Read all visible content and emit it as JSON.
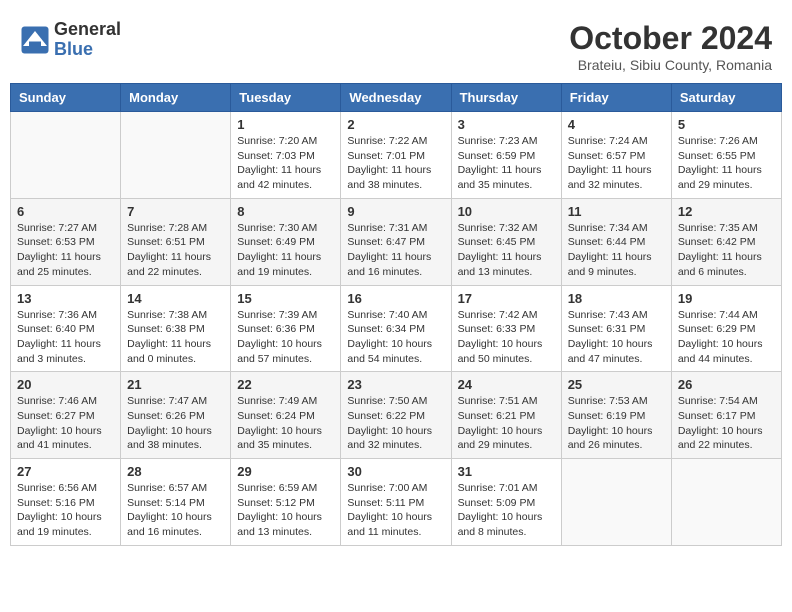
{
  "header": {
    "logo_general": "General",
    "logo_blue": "Blue",
    "month_year": "October 2024",
    "location": "Brateiu, Sibiu County, Romania"
  },
  "days_of_week": [
    "Sunday",
    "Monday",
    "Tuesday",
    "Wednesday",
    "Thursday",
    "Friday",
    "Saturday"
  ],
  "weeks": [
    [
      {
        "day": "",
        "info": ""
      },
      {
        "day": "",
        "info": ""
      },
      {
        "day": "1",
        "info": "Sunrise: 7:20 AM\nSunset: 7:03 PM\nDaylight: 11 hours and 42 minutes."
      },
      {
        "day": "2",
        "info": "Sunrise: 7:22 AM\nSunset: 7:01 PM\nDaylight: 11 hours and 38 minutes."
      },
      {
        "day": "3",
        "info": "Sunrise: 7:23 AM\nSunset: 6:59 PM\nDaylight: 11 hours and 35 minutes."
      },
      {
        "day": "4",
        "info": "Sunrise: 7:24 AM\nSunset: 6:57 PM\nDaylight: 11 hours and 32 minutes."
      },
      {
        "day": "5",
        "info": "Sunrise: 7:26 AM\nSunset: 6:55 PM\nDaylight: 11 hours and 29 minutes."
      }
    ],
    [
      {
        "day": "6",
        "info": "Sunrise: 7:27 AM\nSunset: 6:53 PM\nDaylight: 11 hours and 25 minutes."
      },
      {
        "day": "7",
        "info": "Sunrise: 7:28 AM\nSunset: 6:51 PM\nDaylight: 11 hours and 22 minutes."
      },
      {
        "day": "8",
        "info": "Sunrise: 7:30 AM\nSunset: 6:49 PM\nDaylight: 11 hours and 19 minutes."
      },
      {
        "day": "9",
        "info": "Sunrise: 7:31 AM\nSunset: 6:47 PM\nDaylight: 11 hours and 16 minutes."
      },
      {
        "day": "10",
        "info": "Sunrise: 7:32 AM\nSunset: 6:45 PM\nDaylight: 11 hours and 13 minutes."
      },
      {
        "day": "11",
        "info": "Sunrise: 7:34 AM\nSunset: 6:44 PM\nDaylight: 11 hours and 9 minutes."
      },
      {
        "day": "12",
        "info": "Sunrise: 7:35 AM\nSunset: 6:42 PM\nDaylight: 11 hours and 6 minutes."
      }
    ],
    [
      {
        "day": "13",
        "info": "Sunrise: 7:36 AM\nSunset: 6:40 PM\nDaylight: 11 hours and 3 minutes."
      },
      {
        "day": "14",
        "info": "Sunrise: 7:38 AM\nSunset: 6:38 PM\nDaylight: 11 hours and 0 minutes."
      },
      {
        "day": "15",
        "info": "Sunrise: 7:39 AM\nSunset: 6:36 PM\nDaylight: 10 hours and 57 minutes."
      },
      {
        "day": "16",
        "info": "Sunrise: 7:40 AM\nSunset: 6:34 PM\nDaylight: 10 hours and 54 minutes."
      },
      {
        "day": "17",
        "info": "Sunrise: 7:42 AM\nSunset: 6:33 PM\nDaylight: 10 hours and 50 minutes."
      },
      {
        "day": "18",
        "info": "Sunrise: 7:43 AM\nSunset: 6:31 PM\nDaylight: 10 hours and 47 minutes."
      },
      {
        "day": "19",
        "info": "Sunrise: 7:44 AM\nSunset: 6:29 PM\nDaylight: 10 hours and 44 minutes."
      }
    ],
    [
      {
        "day": "20",
        "info": "Sunrise: 7:46 AM\nSunset: 6:27 PM\nDaylight: 10 hours and 41 minutes."
      },
      {
        "day": "21",
        "info": "Sunrise: 7:47 AM\nSunset: 6:26 PM\nDaylight: 10 hours and 38 minutes."
      },
      {
        "day": "22",
        "info": "Sunrise: 7:49 AM\nSunset: 6:24 PM\nDaylight: 10 hours and 35 minutes."
      },
      {
        "day": "23",
        "info": "Sunrise: 7:50 AM\nSunset: 6:22 PM\nDaylight: 10 hours and 32 minutes."
      },
      {
        "day": "24",
        "info": "Sunrise: 7:51 AM\nSunset: 6:21 PM\nDaylight: 10 hours and 29 minutes."
      },
      {
        "day": "25",
        "info": "Sunrise: 7:53 AM\nSunset: 6:19 PM\nDaylight: 10 hours and 26 minutes."
      },
      {
        "day": "26",
        "info": "Sunrise: 7:54 AM\nSunset: 6:17 PM\nDaylight: 10 hours and 22 minutes."
      }
    ],
    [
      {
        "day": "27",
        "info": "Sunrise: 6:56 AM\nSunset: 5:16 PM\nDaylight: 10 hours and 19 minutes."
      },
      {
        "day": "28",
        "info": "Sunrise: 6:57 AM\nSunset: 5:14 PM\nDaylight: 10 hours and 16 minutes."
      },
      {
        "day": "29",
        "info": "Sunrise: 6:59 AM\nSunset: 5:12 PM\nDaylight: 10 hours and 13 minutes."
      },
      {
        "day": "30",
        "info": "Sunrise: 7:00 AM\nSunset: 5:11 PM\nDaylight: 10 hours and 11 minutes."
      },
      {
        "day": "31",
        "info": "Sunrise: 7:01 AM\nSunset: 5:09 PM\nDaylight: 10 hours and 8 minutes."
      },
      {
        "day": "",
        "info": ""
      },
      {
        "day": "",
        "info": ""
      }
    ]
  ]
}
